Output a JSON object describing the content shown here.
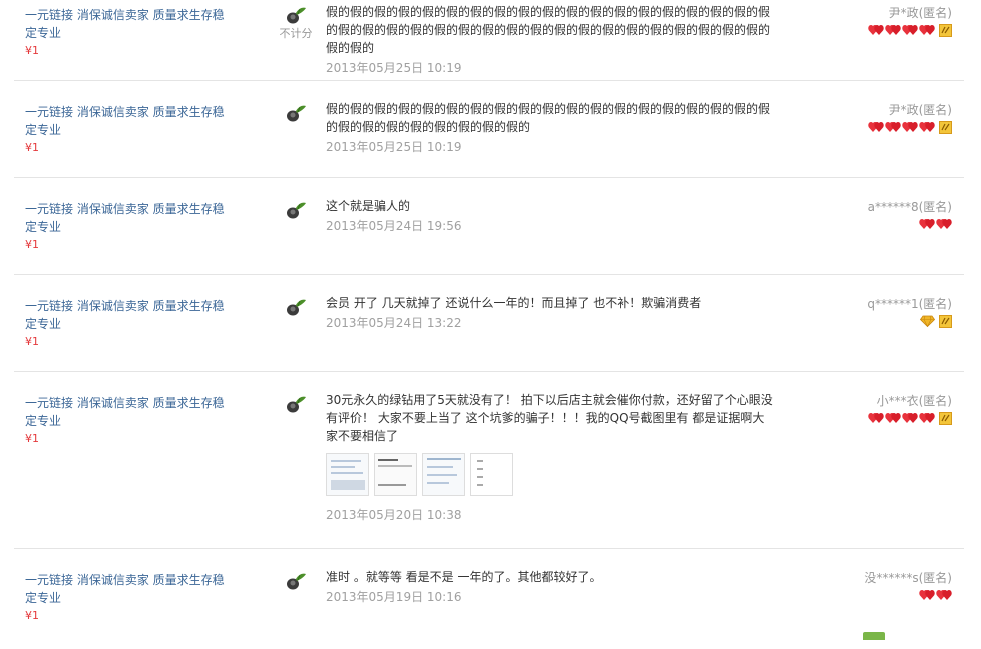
{
  "reviews": [
    {
      "item_title": "一元链接 消保诚信卖家 质量求生存稳定专业",
      "price": "¥1",
      "text": "假的假的假的假的假的假的假的假的假的假的假的假的假的假的假的假的假的假的假的假的假的假的假的假的假的假的假的假的假的假的假的假的假的假的假的假的假的假的假的",
      "date": "2013年05月25日 10:19",
      "user": "尹*政(匿名)",
      "hearts": 4,
      "vip": true,
      "nocount_label": "不计分"
    },
    {
      "item_title": "一元链接 消保诚信卖家 质量求生存稳定专业",
      "price": "¥1",
      "text": "假的假的假的假的假的假的假的假的假的假的假的假的假的假的假的假的假的假的假的假的假的假的假的假的假的假的假的",
      "date": "2013年05月25日 10:19",
      "user": "尹*政(匿名)",
      "hearts": 4,
      "vip": true
    },
    {
      "item_title": "一元链接 消保诚信卖家 质量求生存稳定专业",
      "price": "¥1",
      "text": "这个就是骗人的",
      "date": "2013年05月24日 19:56",
      "user": "a******8(匿名)",
      "hearts": 2,
      "vip": false
    },
    {
      "item_title": "一元链接 消保诚信卖家 质量求生存稳定专业",
      "price": "¥1",
      "text": "会员 开了 几天就掉了 还说什么一年的！而且掉了 也不补！欺骗消费者",
      "date": "2013年05月24日 13:22",
      "user": "q******1(匿名)",
      "diamond": true,
      "vip": true
    },
    {
      "item_title": "一元链接 消保诚信卖家 质量求生存稳定专业",
      "price": "¥1",
      "text": "30元永久的绿钻用了5天就没有了！ 拍下以后店主就会催你付款，还好留了个心眼没有评价！ 大家不要上当了 这个坑爹的骗子！！！我的QQ号截图里有 都是证据啊大家不要相信了",
      "date": "2013年05月20日 10:38",
      "user": "小***衣(匿名)",
      "hearts": 4,
      "vip": true,
      "thumbs": 4
    },
    {
      "item_title": "一元链接 消保诚信卖家 质量求生存稳定专业",
      "price": "¥1",
      "text": "准时 。就等等 看是不是 一年的了。其他都较好了。",
      "date": "2013年05月19日 10:16",
      "user": "没******s(匿名)",
      "hearts": 2,
      "vip": false
    }
  ]
}
